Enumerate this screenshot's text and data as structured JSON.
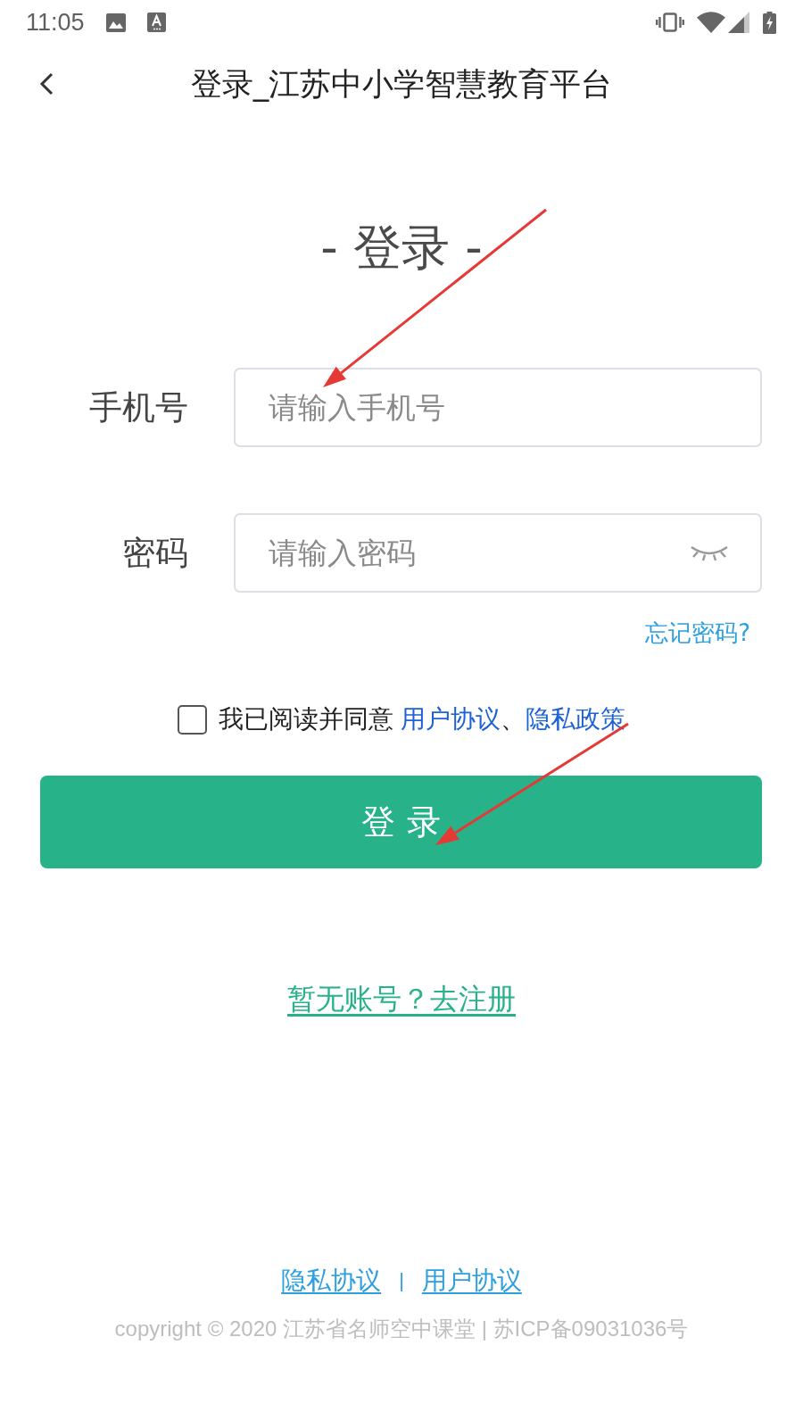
{
  "status_bar": {
    "time": "11:05"
  },
  "header": {
    "title": "登录_江苏中小学智慧教育平台"
  },
  "heading": "- 登录 -",
  "fields": [
    {
      "kind": "text",
      "label": "手机号",
      "placeholder": "请输入手机号"
    },
    {
      "kind": "password",
      "label": "密码",
      "placeholder": "请输入密码",
      "visible": false
    }
  ],
  "forgot_password": "忘记密码?",
  "agreement": {
    "checked": false,
    "parts": [
      {
        "kind": "text",
        "text": "我已阅读并同意"
      },
      {
        "kind": "link",
        "text": "用户协议"
      },
      {
        "kind": "text",
        "text": "、"
      },
      {
        "kind": "link",
        "text": "隐私政策"
      }
    ]
  },
  "login_button": "登 录",
  "register_link": "暂无账号？去注册",
  "footer": {
    "links": [
      "隐私协议",
      "用户协议"
    ],
    "separator": "|",
    "copyright": "copyright © 2020 江苏省名师空中课堂 | 苏ICP备09031036号"
  },
  "annotations": [
    {
      "kind": "arrow"
    },
    {
      "kind": "arrow"
    }
  ]
}
